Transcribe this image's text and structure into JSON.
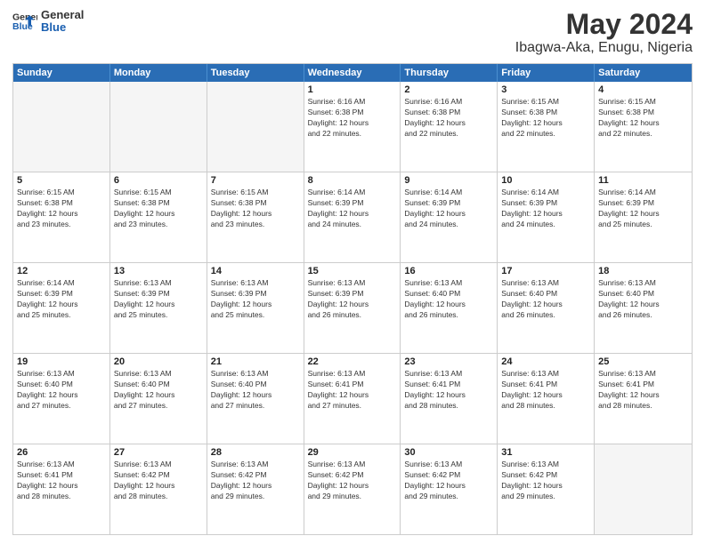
{
  "header": {
    "logo_line1": "General",
    "logo_line2": "Blue",
    "title": "May 2024",
    "subtitle": "Ibagwa-Aka, Enugu, Nigeria"
  },
  "calendar": {
    "days_of_week": [
      "Sunday",
      "Monday",
      "Tuesday",
      "Wednesday",
      "Thursday",
      "Friday",
      "Saturday"
    ],
    "rows": [
      [
        {
          "num": "",
          "info": "",
          "empty": true
        },
        {
          "num": "",
          "info": "",
          "empty": true
        },
        {
          "num": "",
          "info": "",
          "empty": true
        },
        {
          "num": "1",
          "info": "Sunrise: 6:16 AM\nSunset: 6:38 PM\nDaylight: 12 hours\nand 22 minutes."
        },
        {
          "num": "2",
          "info": "Sunrise: 6:16 AM\nSunset: 6:38 PM\nDaylight: 12 hours\nand 22 minutes."
        },
        {
          "num": "3",
          "info": "Sunrise: 6:15 AM\nSunset: 6:38 PM\nDaylight: 12 hours\nand 22 minutes."
        },
        {
          "num": "4",
          "info": "Sunrise: 6:15 AM\nSunset: 6:38 PM\nDaylight: 12 hours\nand 22 minutes."
        }
      ],
      [
        {
          "num": "5",
          "info": "Sunrise: 6:15 AM\nSunset: 6:38 PM\nDaylight: 12 hours\nand 23 minutes."
        },
        {
          "num": "6",
          "info": "Sunrise: 6:15 AM\nSunset: 6:38 PM\nDaylight: 12 hours\nand 23 minutes."
        },
        {
          "num": "7",
          "info": "Sunrise: 6:15 AM\nSunset: 6:38 PM\nDaylight: 12 hours\nand 23 minutes."
        },
        {
          "num": "8",
          "info": "Sunrise: 6:14 AM\nSunset: 6:39 PM\nDaylight: 12 hours\nand 24 minutes."
        },
        {
          "num": "9",
          "info": "Sunrise: 6:14 AM\nSunset: 6:39 PM\nDaylight: 12 hours\nand 24 minutes."
        },
        {
          "num": "10",
          "info": "Sunrise: 6:14 AM\nSunset: 6:39 PM\nDaylight: 12 hours\nand 24 minutes."
        },
        {
          "num": "11",
          "info": "Sunrise: 6:14 AM\nSunset: 6:39 PM\nDaylight: 12 hours\nand 25 minutes."
        }
      ],
      [
        {
          "num": "12",
          "info": "Sunrise: 6:14 AM\nSunset: 6:39 PM\nDaylight: 12 hours\nand 25 minutes."
        },
        {
          "num": "13",
          "info": "Sunrise: 6:13 AM\nSunset: 6:39 PM\nDaylight: 12 hours\nand 25 minutes."
        },
        {
          "num": "14",
          "info": "Sunrise: 6:13 AM\nSunset: 6:39 PM\nDaylight: 12 hours\nand 25 minutes."
        },
        {
          "num": "15",
          "info": "Sunrise: 6:13 AM\nSunset: 6:39 PM\nDaylight: 12 hours\nand 26 minutes."
        },
        {
          "num": "16",
          "info": "Sunrise: 6:13 AM\nSunset: 6:40 PM\nDaylight: 12 hours\nand 26 minutes."
        },
        {
          "num": "17",
          "info": "Sunrise: 6:13 AM\nSunset: 6:40 PM\nDaylight: 12 hours\nand 26 minutes."
        },
        {
          "num": "18",
          "info": "Sunrise: 6:13 AM\nSunset: 6:40 PM\nDaylight: 12 hours\nand 26 minutes."
        }
      ],
      [
        {
          "num": "19",
          "info": "Sunrise: 6:13 AM\nSunset: 6:40 PM\nDaylight: 12 hours\nand 27 minutes."
        },
        {
          "num": "20",
          "info": "Sunrise: 6:13 AM\nSunset: 6:40 PM\nDaylight: 12 hours\nand 27 minutes."
        },
        {
          "num": "21",
          "info": "Sunrise: 6:13 AM\nSunset: 6:40 PM\nDaylight: 12 hours\nand 27 minutes."
        },
        {
          "num": "22",
          "info": "Sunrise: 6:13 AM\nSunset: 6:41 PM\nDaylight: 12 hours\nand 27 minutes."
        },
        {
          "num": "23",
          "info": "Sunrise: 6:13 AM\nSunset: 6:41 PM\nDaylight: 12 hours\nand 28 minutes."
        },
        {
          "num": "24",
          "info": "Sunrise: 6:13 AM\nSunset: 6:41 PM\nDaylight: 12 hours\nand 28 minutes."
        },
        {
          "num": "25",
          "info": "Sunrise: 6:13 AM\nSunset: 6:41 PM\nDaylight: 12 hours\nand 28 minutes."
        }
      ],
      [
        {
          "num": "26",
          "info": "Sunrise: 6:13 AM\nSunset: 6:41 PM\nDaylight: 12 hours\nand 28 minutes."
        },
        {
          "num": "27",
          "info": "Sunrise: 6:13 AM\nSunset: 6:42 PM\nDaylight: 12 hours\nand 28 minutes."
        },
        {
          "num": "28",
          "info": "Sunrise: 6:13 AM\nSunset: 6:42 PM\nDaylight: 12 hours\nand 29 minutes."
        },
        {
          "num": "29",
          "info": "Sunrise: 6:13 AM\nSunset: 6:42 PM\nDaylight: 12 hours\nand 29 minutes."
        },
        {
          "num": "30",
          "info": "Sunrise: 6:13 AM\nSunset: 6:42 PM\nDaylight: 12 hours\nand 29 minutes."
        },
        {
          "num": "31",
          "info": "Sunrise: 6:13 AM\nSunset: 6:42 PM\nDaylight: 12 hours\nand 29 minutes."
        },
        {
          "num": "",
          "info": "",
          "empty": true
        }
      ]
    ]
  }
}
